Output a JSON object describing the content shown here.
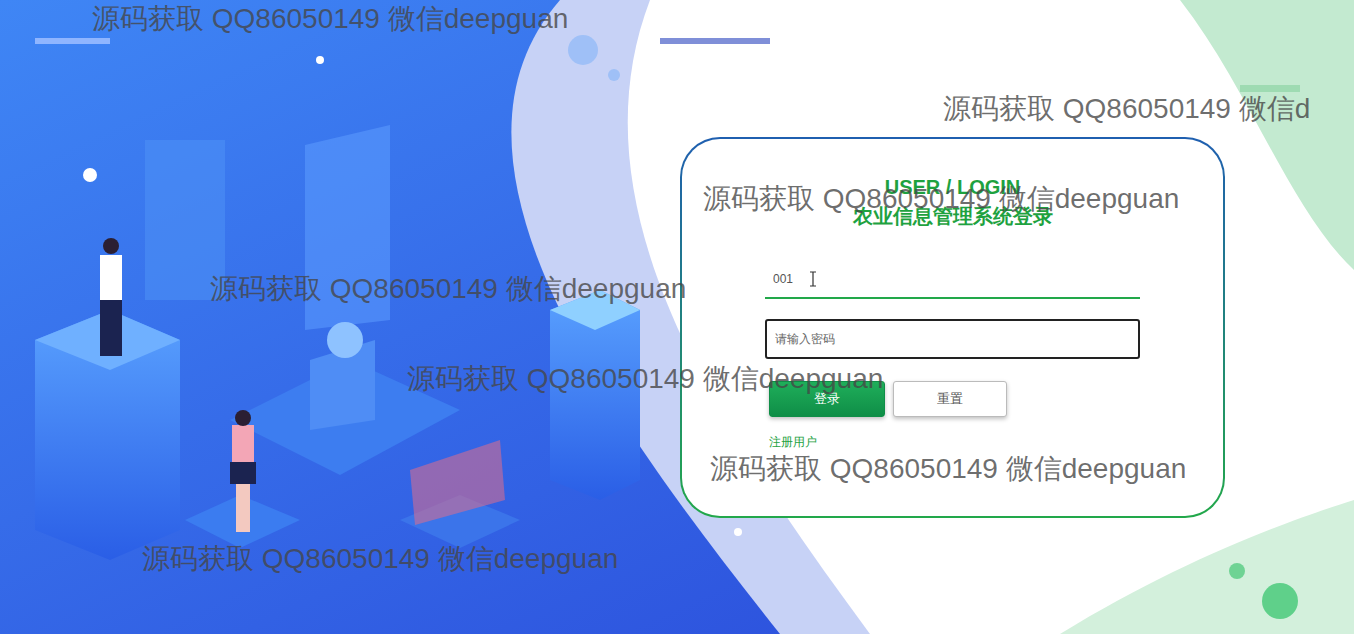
{
  "title": "USER / LOGIN",
  "subtitle": "农业信息管理系统登录",
  "username": {
    "value": "001"
  },
  "password": {
    "placeholder": "请输入密码",
    "focused": true
  },
  "buttons": [
    {
      "label": "登录",
      "kind": "primary"
    },
    {
      "label": "重置",
      "kind": "secondary"
    }
  ],
  "register_link": "注册用户",
  "watermarks": [
    "源码获取 QQ86050149 微信deepguan",
    "源码获取 QQ86050149 微信d",
    "源码获取 QQ86050149 微信deepguan",
    "源码获取 QQ86050149 微信deepguan",
    "源码获取 QQ86050149 微信deepguan",
    "源码获取 QQ86050149 微信deepguan",
    "源码获取 QQ86050149 微信deepguan"
  ]
}
